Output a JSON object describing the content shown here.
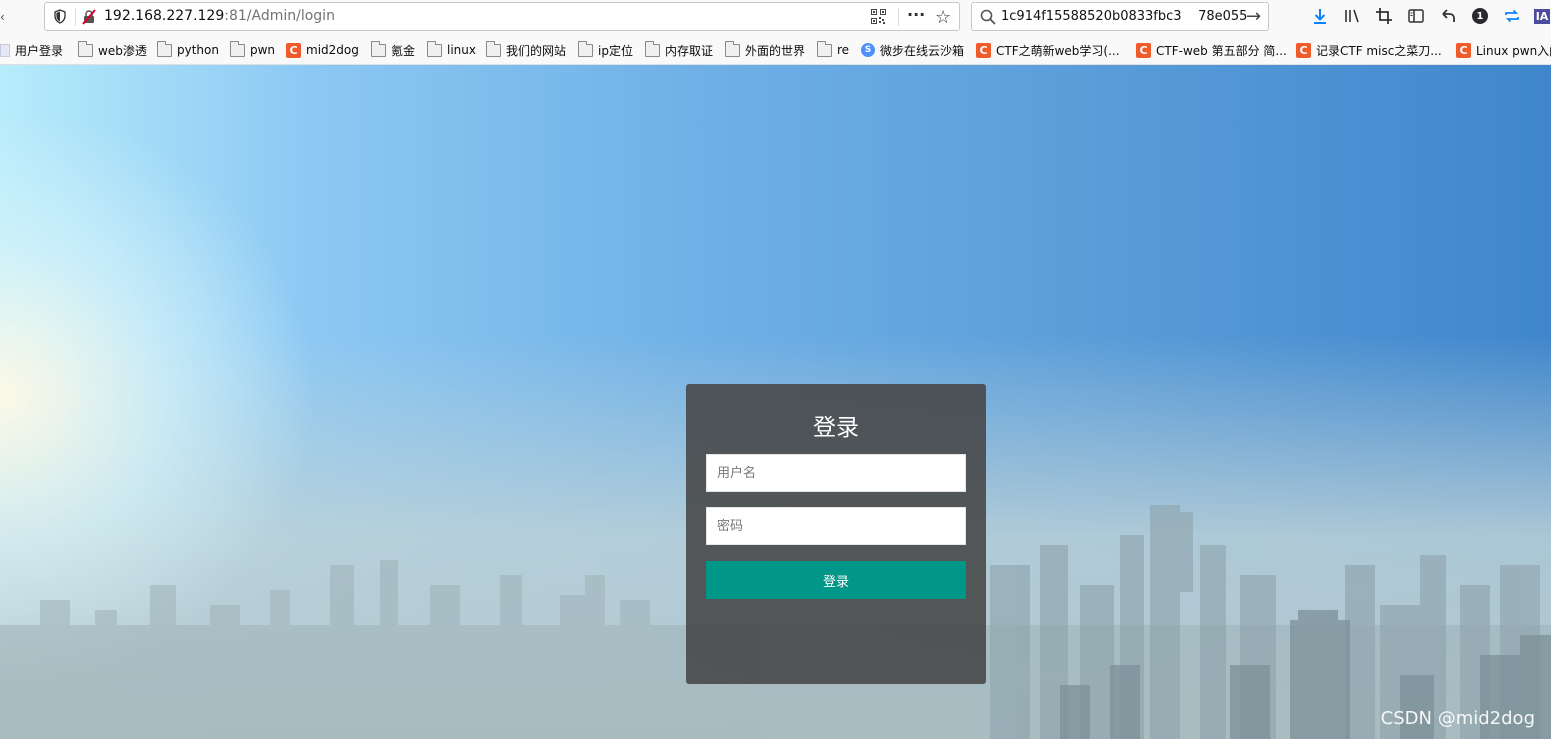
{
  "toolbar": {
    "url_host": "192.168.227.129",
    "url_rest": ":81/Admin/login",
    "search_query": "1c914f15588520b0833fbc3    78e055",
    "profile_badge": "1",
    "extension_label": "IA"
  },
  "bookmarks": [
    {
      "label": "用户登录",
      "icon": "page-icon"
    },
    {
      "label": "web渗透",
      "icon": "folder-icon"
    },
    {
      "label": "python",
      "icon": "folder-icon"
    },
    {
      "label": "pwn",
      "icon": "folder-icon"
    },
    {
      "label": "mid2dog",
      "icon": "csdn-icon"
    },
    {
      "label": "氪金",
      "icon": "folder-icon"
    },
    {
      "label": "linux",
      "icon": "folder-icon"
    },
    {
      "label": "我们的网站",
      "icon": "folder-icon"
    },
    {
      "label": "ip定位",
      "icon": "folder-icon"
    },
    {
      "label": "内存取证",
      "icon": "folder-icon"
    },
    {
      "label": "外面的世界",
      "icon": "folder-icon"
    },
    {
      "label": "re",
      "icon": "folder-icon"
    },
    {
      "label": "微步在线云沙箱",
      "icon": "weibu-icon"
    },
    {
      "label": "CTF之萌新web学习(...",
      "icon": "csdn-icon"
    },
    {
      "label": "CTF-web 第五部分 简...",
      "icon": "csdn-icon"
    },
    {
      "label": "记录CTF misc之菜刀...",
      "icon": "csdn-icon"
    },
    {
      "label": "Linux pwn入门",
      "icon": "csdn-icon"
    }
  ],
  "login": {
    "title": "登录",
    "username_placeholder": "用户名",
    "password_placeholder": "密码",
    "submit_label": "登录",
    "button_color": "#009688"
  },
  "watermark": "CSDN @mid2dog"
}
